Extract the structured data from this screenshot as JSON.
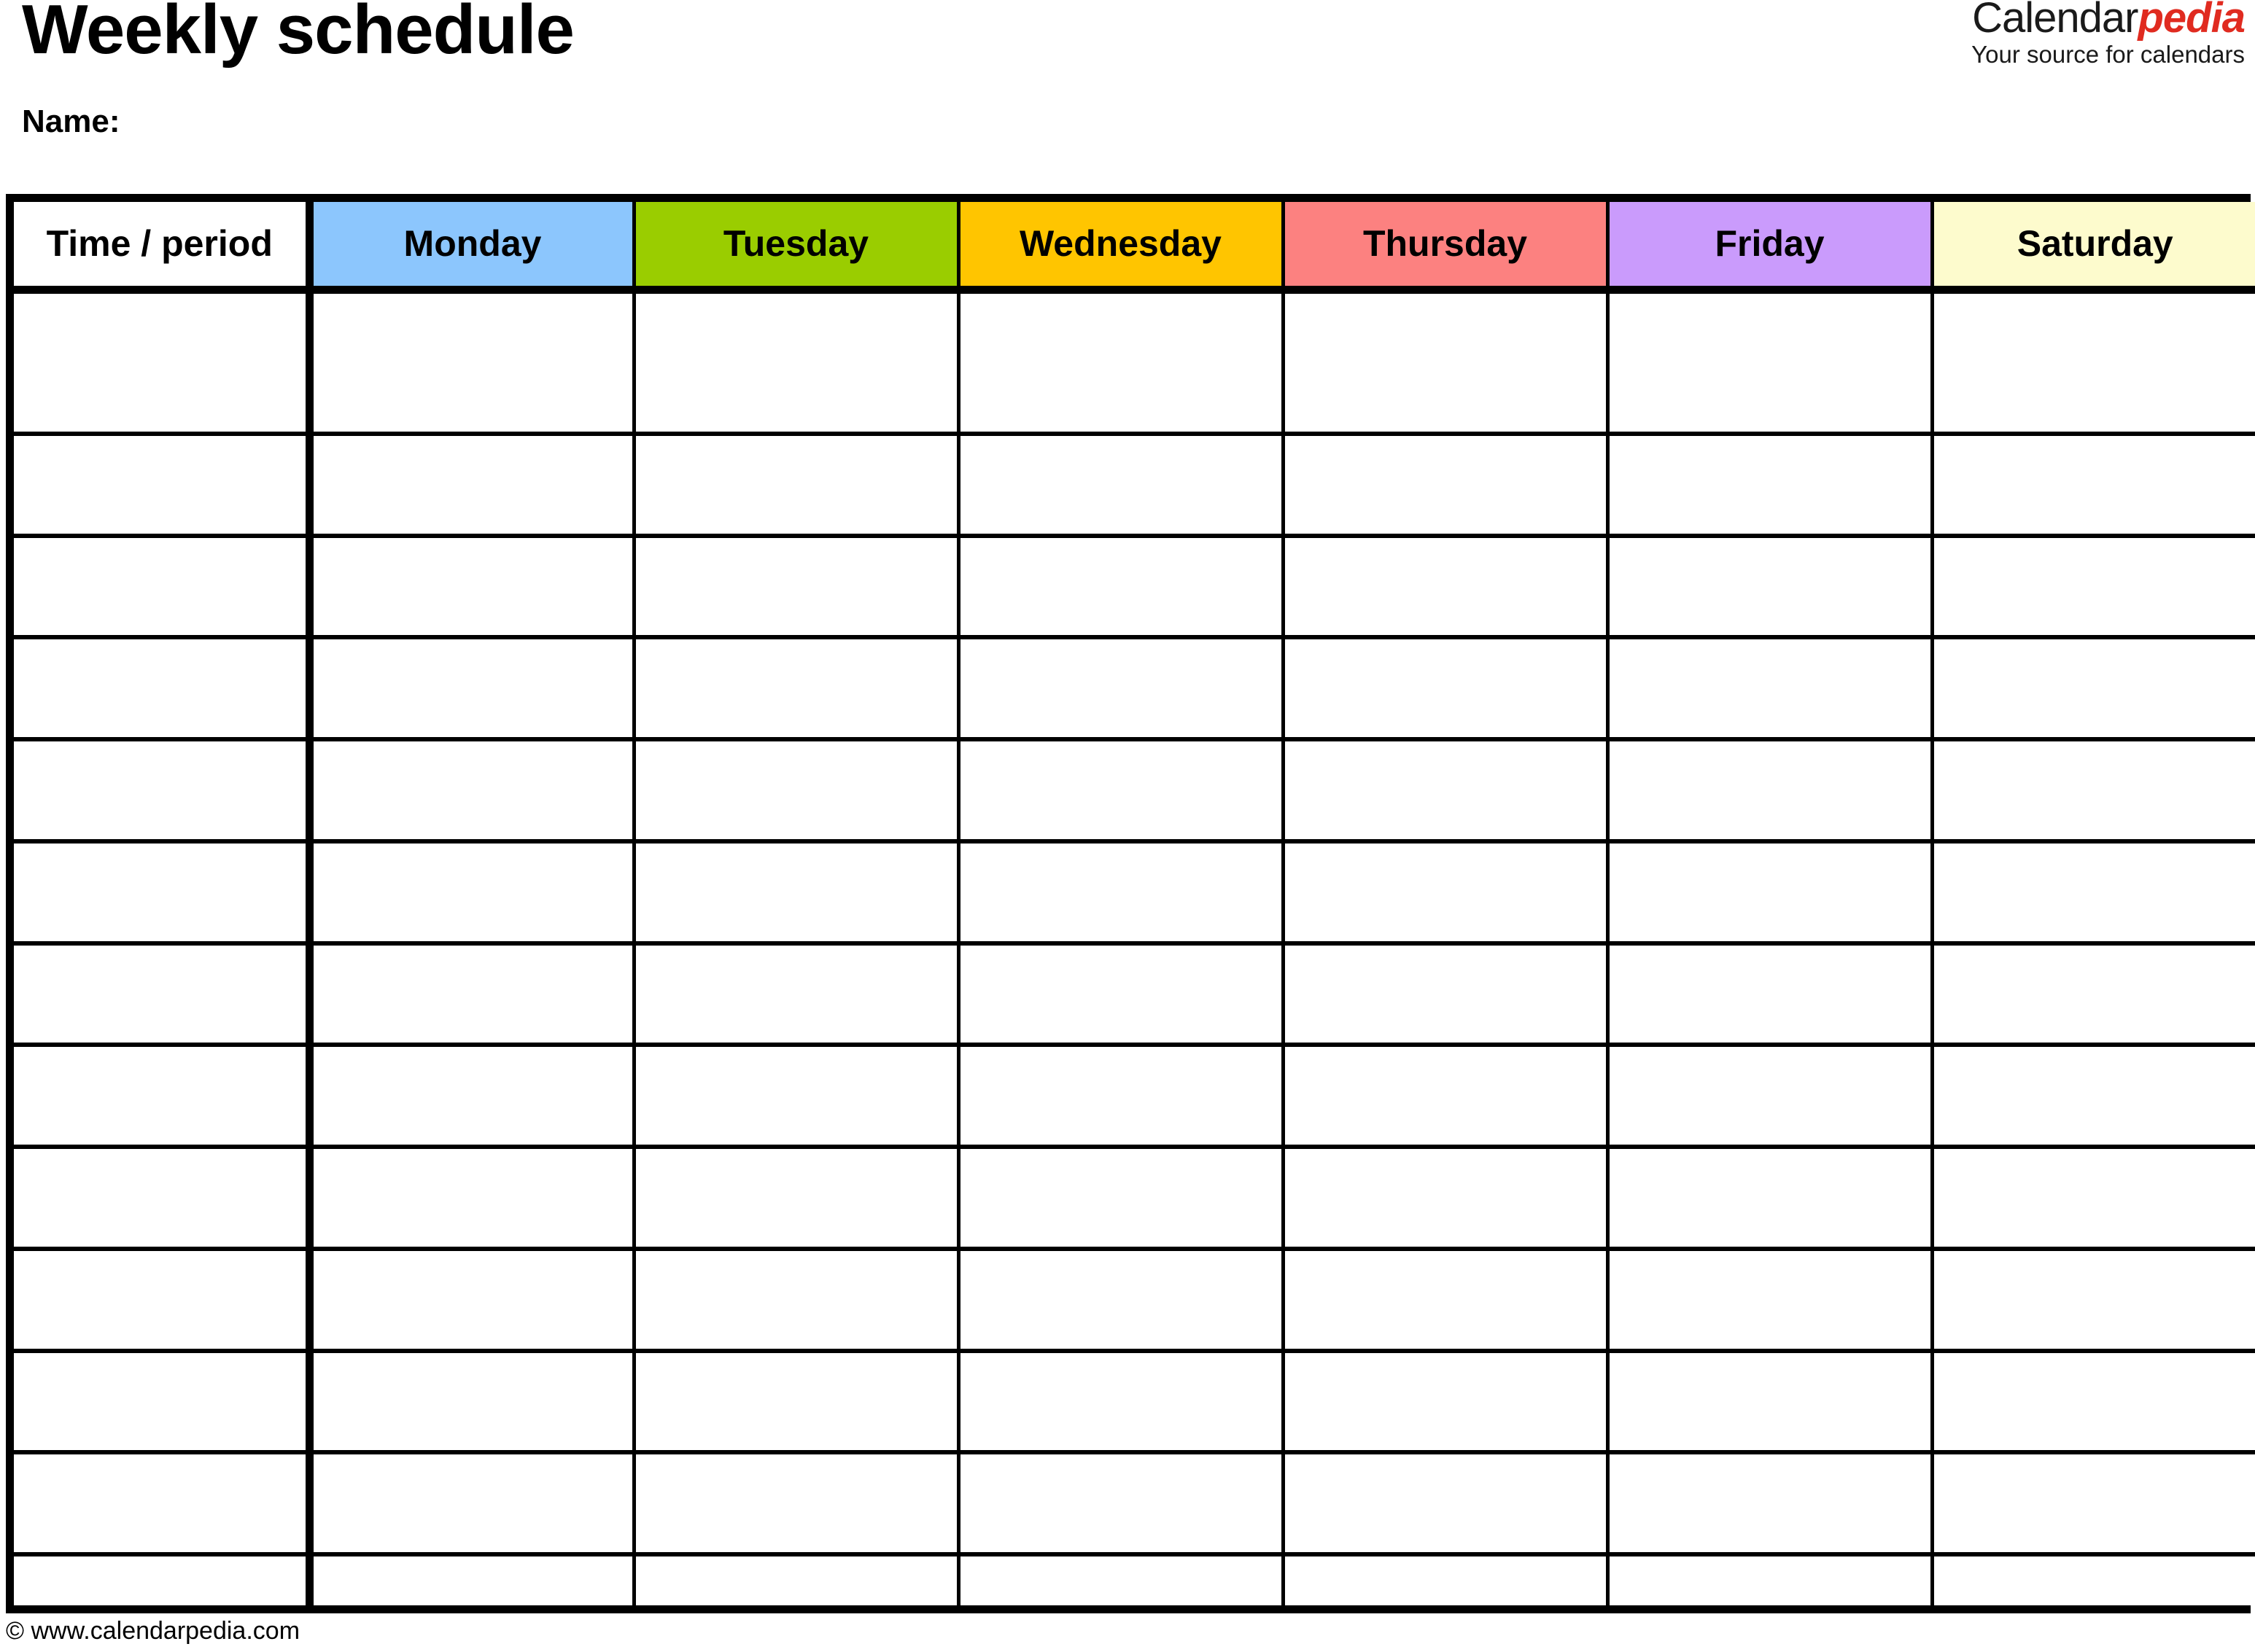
{
  "document": {
    "title": "Weekly schedule",
    "name_label": "Name:"
  },
  "brand": {
    "word_primary": "Calendar",
    "word_accent": "pedia",
    "tagline": "Your source for calendars",
    "accent_color": "#e02b20",
    "primary_color": "#1a1a1a"
  },
  "table": {
    "columns": [
      {
        "key": "time",
        "label": "Time / period",
        "bg": "#ffffff"
      },
      {
        "key": "monday",
        "label": "Monday",
        "bg": "#8cc6fd"
      },
      {
        "key": "tuesday",
        "label": "Tuesday",
        "bg": "#9acd00"
      },
      {
        "key": "wednesday",
        "label": "Wednesday",
        "bg": "#ffc500"
      },
      {
        "key": "thursday",
        "label": "Thursday",
        "bg": "#fc8180"
      },
      {
        "key": "friday",
        "label": "Friday",
        "bg": "#ca9bfc"
      },
      {
        "key": "saturday",
        "label": "Saturday",
        "bg": "#fdfbcd"
      }
    ],
    "row_count": 13,
    "rows": [
      {
        "time": "",
        "monday": "",
        "tuesday": "",
        "wednesday": "",
        "thursday": "",
        "friday": "",
        "saturday": ""
      },
      {
        "time": "",
        "monday": "",
        "tuesday": "",
        "wednesday": "",
        "thursday": "",
        "friday": "",
        "saturday": ""
      },
      {
        "time": "",
        "monday": "",
        "tuesday": "",
        "wednesday": "",
        "thursday": "",
        "friday": "",
        "saturday": ""
      },
      {
        "time": "",
        "monday": "",
        "tuesday": "",
        "wednesday": "",
        "thursday": "",
        "friday": "",
        "saturday": ""
      },
      {
        "time": "",
        "monday": "",
        "tuesday": "",
        "wednesday": "",
        "thursday": "",
        "friday": "",
        "saturday": ""
      },
      {
        "time": "",
        "monday": "",
        "tuesday": "",
        "wednesday": "",
        "thursday": "",
        "friday": "",
        "saturday": ""
      },
      {
        "time": "",
        "monday": "",
        "tuesday": "",
        "wednesday": "",
        "thursday": "",
        "friday": "",
        "saturday": ""
      },
      {
        "time": "",
        "monday": "",
        "tuesday": "",
        "wednesday": "",
        "thursday": "",
        "friday": "",
        "saturday": ""
      },
      {
        "time": "",
        "monday": "",
        "tuesday": "",
        "wednesday": "",
        "thursday": "",
        "friday": "",
        "saturday": ""
      },
      {
        "time": "",
        "monday": "",
        "tuesday": "",
        "wednesday": "",
        "thursday": "",
        "friday": "",
        "saturday": ""
      },
      {
        "time": "",
        "monday": "",
        "tuesday": "",
        "wednesday": "",
        "thursday": "",
        "friday": "",
        "saturday": ""
      },
      {
        "time": "",
        "monday": "",
        "tuesday": "",
        "wednesday": "",
        "thursday": "",
        "friday": "",
        "saturday": ""
      },
      {
        "time": "",
        "monday": "",
        "tuesday": "",
        "wednesday": "",
        "thursday": "",
        "friday": "",
        "saturday": ""
      }
    ]
  },
  "footer": {
    "copyright": "© www.calendarpedia.com"
  }
}
